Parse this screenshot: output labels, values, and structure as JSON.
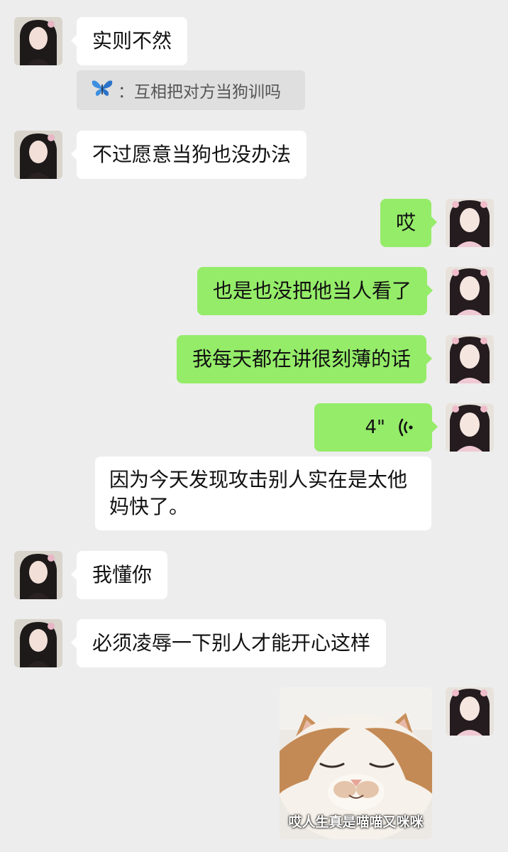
{
  "messages": {
    "m1": "实则不然",
    "quote": {
      "icon": "butterfly-icon",
      "separator": "：",
      "text": "互相把对方当狗训吗"
    },
    "m2": "不过愿意当狗也没办法",
    "m3": "哎",
    "m4": "也是也没把他当人看了",
    "m5": "我每天都在讲很刻薄的话",
    "voice": {
      "duration": "4\"",
      "icon": "voice-wave-icon"
    },
    "m6_line1": "因为今天发现攻击别人实在是太他",
    "m6_line2": "妈快了。",
    "m7": "我懂你",
    "m8": "必须凌辱一下别人才能开心这样",
    "sticker": {
      "caption": "哎人生真是喵喵又咪咪"
    }
  },
  "colors": {
    "background": "#ededed",
    "incoming_bubble": "#ffffff",
    "outgoing_bubble": "#95ec69",
    "quote_bg": "#dfdfdf"
  }
}
